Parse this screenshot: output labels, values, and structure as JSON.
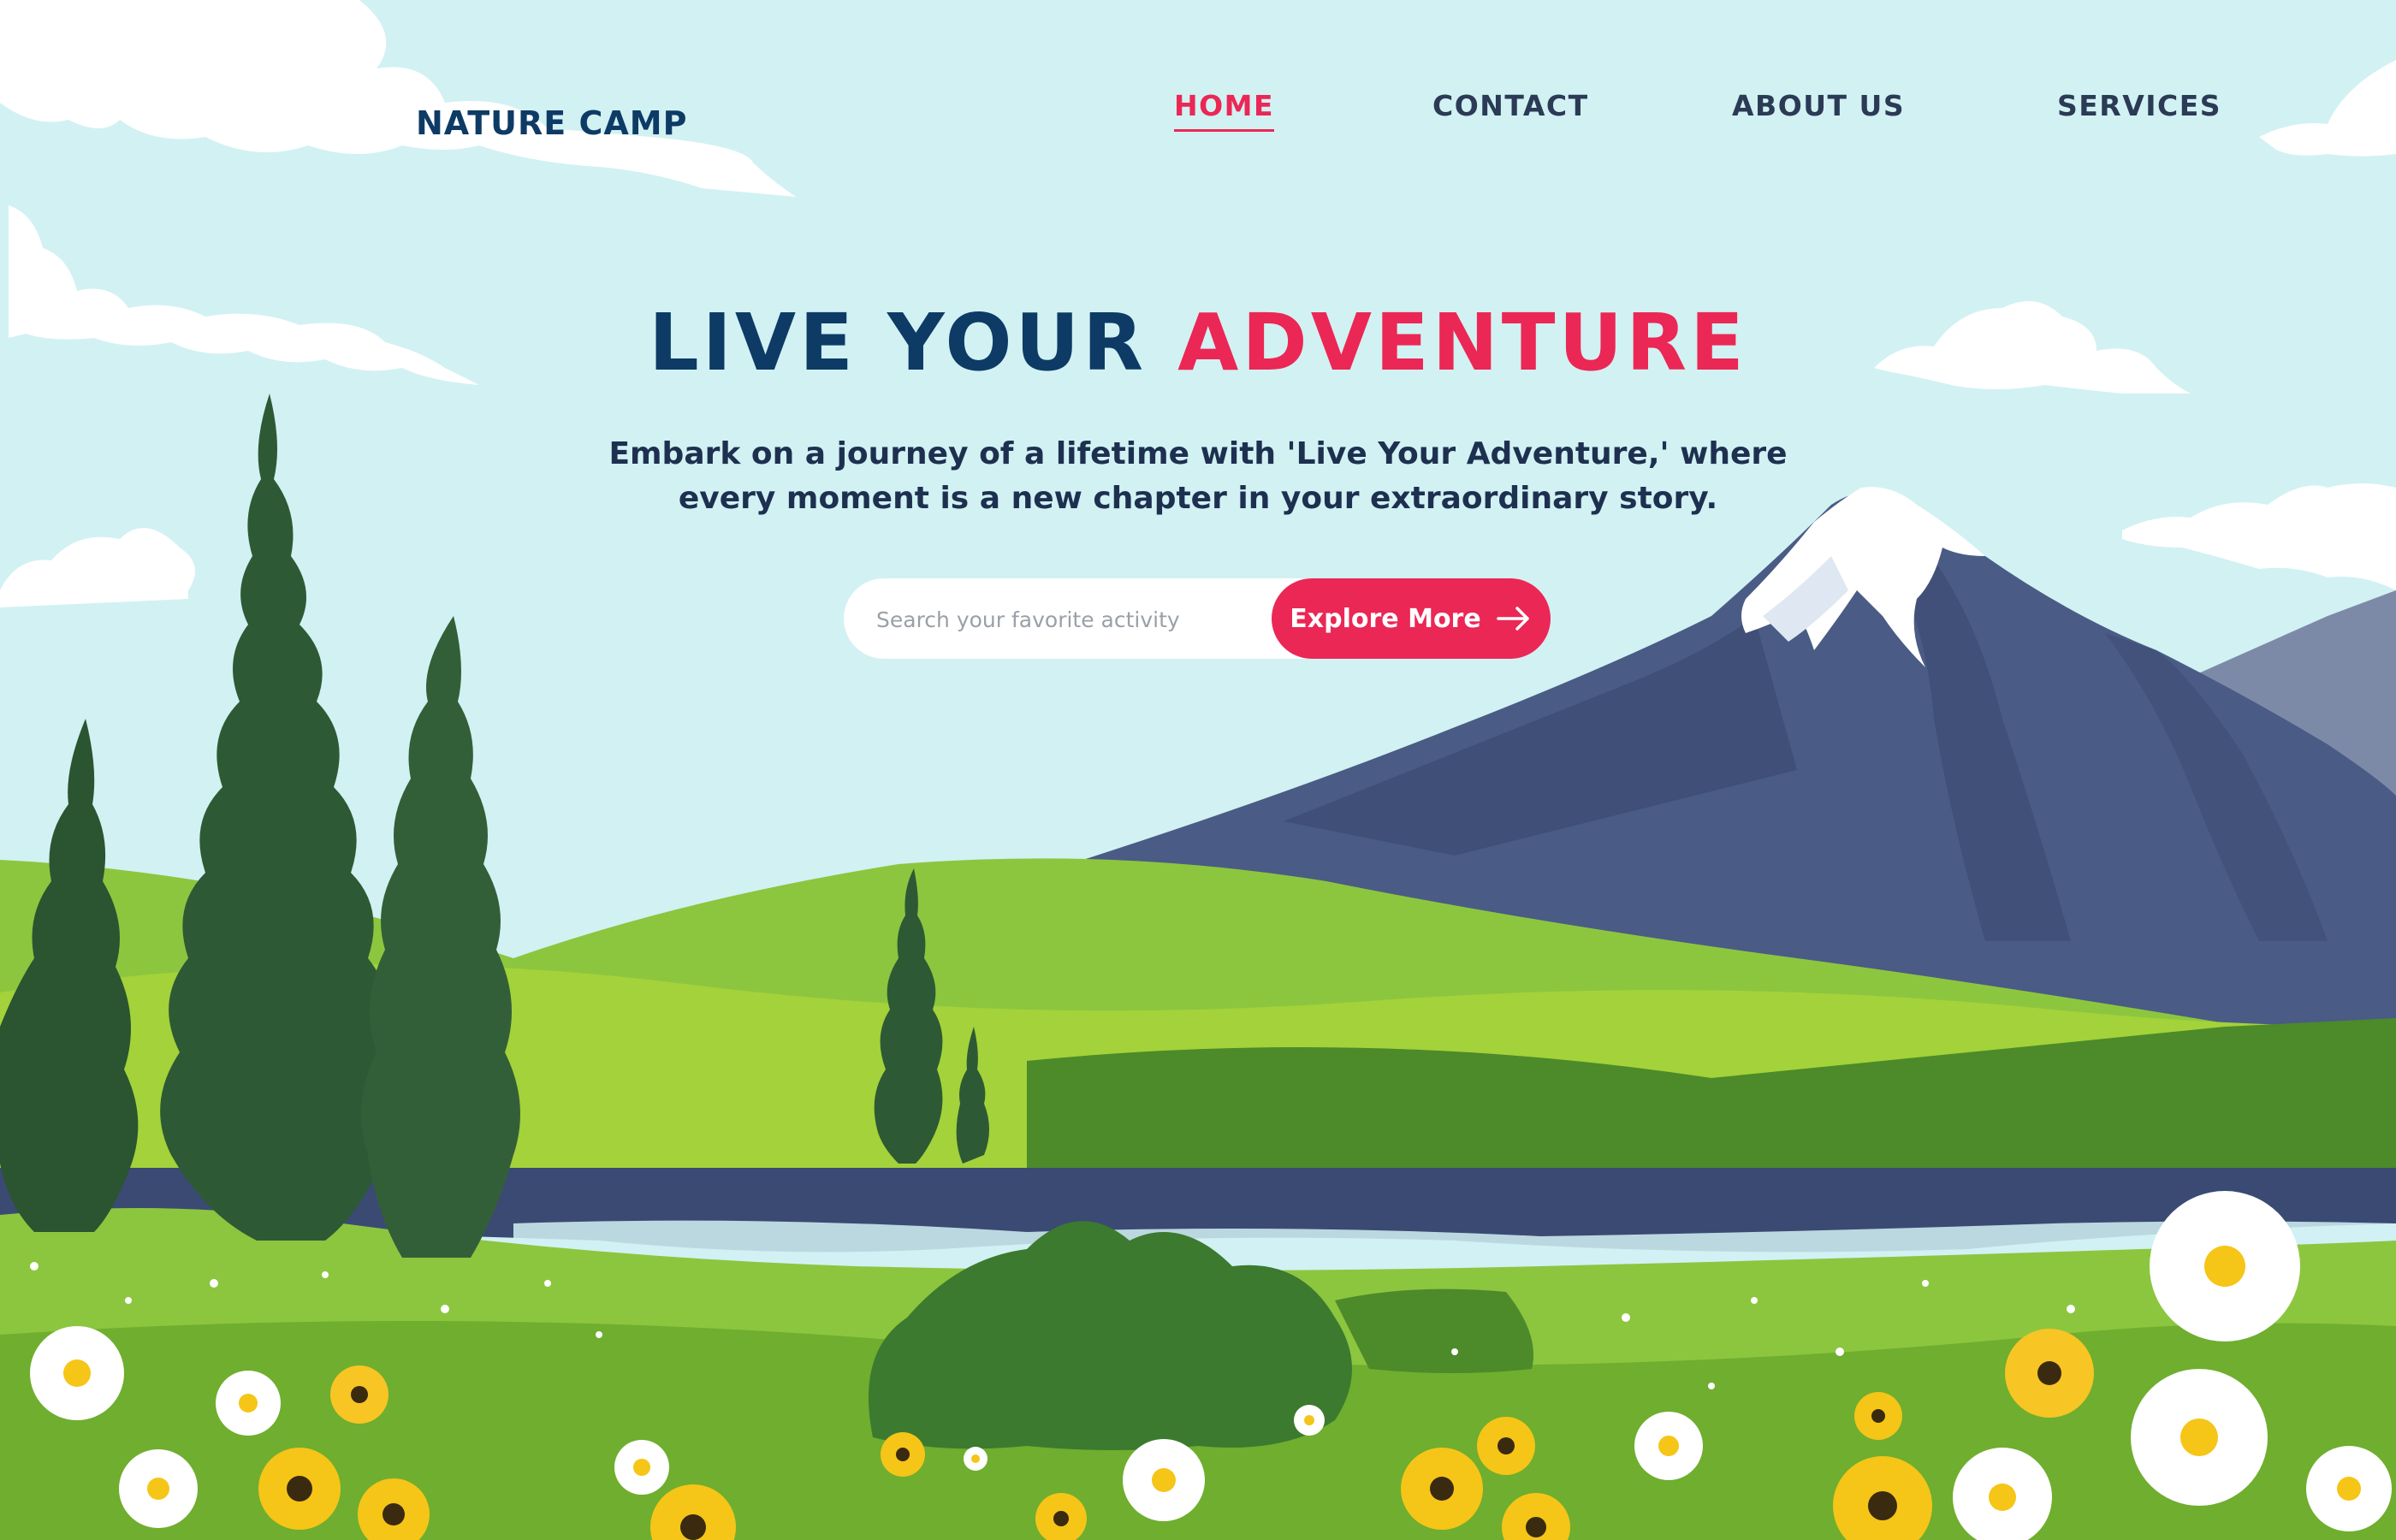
{
  "header": {
    "logo": "NATURE CAMP",
    "nav": [
      {
        "label": "HOME",
        "active": true
      },
      {
        "label": "CONTACT",
        "active": false
      },
      {
        "label": "ABOUT US",
        "active": false
      },
      {
        "label": "SERVICES",
        "active": false
      }
    ]
  },
  "hero": {
    "title_part1": "LIVE YOUR",
    "title_part2": "ADVENTURE",
    "subtitle": "Embark on a journey of a lifetime with 'Live Your Adventure,' where every moment is a new chapter in your extraordinary story.",
    "search": {
      "placeholder": "Search your favorite activity",
      "value": ""
    },
    "cta_label": "Explore More",
    "cta_icon": "arrow-right-icon"
  },
  "colors": {
    "sky": "#d2f1f3",
    "brand_dark": "#0d3b66",
    "accent": "#eb2755",
    "nav_text": "#2b3a55",
    "grass_light": "#8cc63f",
    "grass_dark": "#4d8a2a",
    "tree": "#2d5a34",
    "mountain": "#4a5b85",
    "lake": "#3b4a73"
  },
  "illustration": {
    "icons": [
      "cloud-icon",
      "mountain-icon",
      "pine-tree-icon",
      "daisy-flower-icon",
      "sunflower-icon"
    ]
  }
}
